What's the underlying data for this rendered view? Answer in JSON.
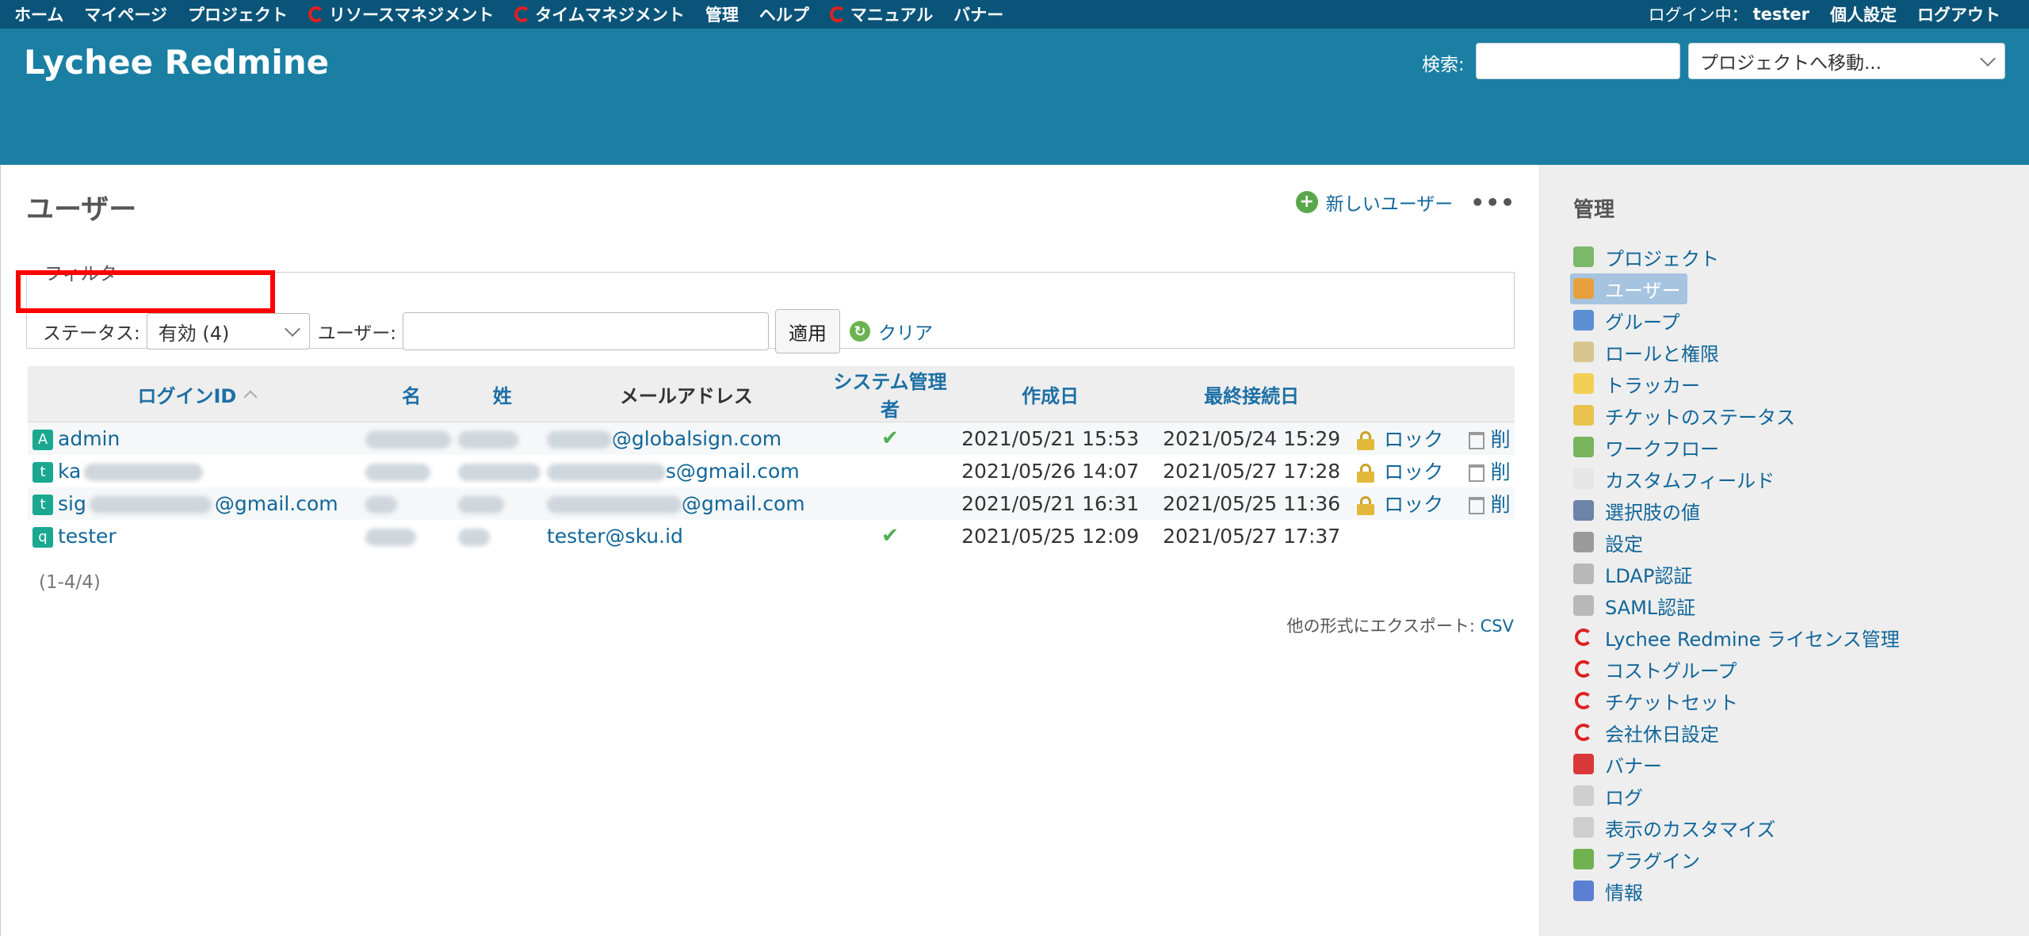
{
  "top_menu": {
    "items": [
      {
        "label": "ホーム",
        "ring": false
      },
      {
        "label": "マイページ",
        "ring": false
      },
      {
        "label": "プロジェクト",
        "ring": false
      },
      {
        "label": "リソースマネジメント",
        "ring": true
      },
      {
        "label": "タイムマネジメント",
        "ring": true
      },
      {
        "label": "管理",
        "ring": false
      },
      {
        "label": "ヘルプ",
        "ring": false
      },
      {
        "label": "マニュアル",
        "ring": true
      },
      {
        "label": "バナー",
        "ring": false
      }
    ],
    "logged_in_label": "ログイン中：",
    "logged_in_user": "tester",
    "my_account": "個人設定",
    "logout": "ログアウト"
  },
  "header": {
    "title": "Lychee Redmine",
    "search_label": "検索:",
    "search_value": "",
    "project_jump": "プロジェクトへ移動..."
  },
  "main": {
    "title": "ユーザー",
    "new_user": "新しいユーザー",
    "filters": {
      "legend": "フィルタ",
      "status_label": "ステータス:",
      "status_value": "有効 (4)",
      "user_label": "ユーザー:",
      "user_value": "",
      "apply": "適用",
      "clear": "クリア"
    },
    "table": {
      "headers": {
        "login": "ログインID",
        "firstname": "名",
        "lastname": "姓",
        "mail": "メールアドレス",
        "admin": "システム管理者",
        "created": "作成日",
        "last_login": "最終接続日"
      },
      "rows": [
        {
          "avatar": "A",
          "login": "admin",
          "mail": "@globalsign.com",
          "admin": "✔",
          "created": "2021/05/21 15:53",
          "last_login": "2021/05/24 15:29",
          "lock": "ロック",
          "delete": "削"
        },
        {
          "avatar": "t",
          "login": "ka",
          "mail": "s@gmail.com",
          "admin": "",
          "created": "2021/05/26 14:07",
          "last_login": "2021/05/27 17:28",
          "lock": "ロック",
          "delete": "削"
        },
        {
          "avatar": "t",
          "login": "sig",
          "login_suffix": "@gmail.com",
          "mail": "@gmail.com",
          "admin": "",
          "created": "2021/05/21 16:31",
          "last_login": "2021/05/25 11:36",
          "lock": "ロック",
          "delete": "削"
        },
        {
          "avatar": "q",
          "login": "tester",
          "mail": "tester@sku.id",
          "admin": "✔",
          "created": "2021/05/25 12:09",
          "last_login": "2021/05/27 17:37",
          "lock": "",
          "delete": ""
        }
      ]
    },
    "pagination": "(1-4/4)",
    "other_formats_label": "他の形式にエクスポート:",
    "csv": "CSV"
  },
  "sidebar": {
    "title": "管理",
    "items": [
      {
        "label": "プロジェクト",
        "icon": "projects-icon",
        "color": "#7cb86a"
      },
      {
        "label": "ユーザー",
        "icon": "user-icon",
        "color": "#e7a13c",
        "selected": true
      },
      {
        "label": "グループ",
        "icon": "group-icon",
        "color": "#5b8fd1"
      },
      {
        "label": "ロールと権限",
        "icon": "roles-icon",
        "color": "#d7c58f"
      },
      {
        "label": "トラッカー",
        "icon": "tracker-icon",
        "color": "#f3cf55"
      },
      {
        "label": "チケットのステータス",
        "icon": "issue-status-icon",
        "color": "#e9c34e"
      },
      {
        "label": "ワークフロー",
        "icon": "workflow-icon",
        "color": "#78b45c"
      },
      {
        "label": "カスタムフィールド",
        "icon": "custom-field-icon",
        "color": "#e6e6e6"
      },
      {
        "label": "選択肢の値",
        "icon": "enumeration-icon",
        "color": "#6b84a8"
      },
      {
        "label": "設定",
        "icon": "settings-icon",
        "color": "#9a9a9a"
      },
      {
        "label": "LDAP認証",
        "icon": "ldap-icon",
        "color": "#b8b8b8"
      },
      {
        "label": "SAML認証",
        "icon": "saml-icon",
        "color": "#b8b8b8"
      },
      {
        "label": "Lychee Redmine ライセンス管理",
        "icon": "lychee-ring-icon",
        "ring": true
      },
      {
        "label": "コストグループ",
        "icon": "lychee-ring-icon",
        "ring": true
      },
      {
        "label": "チケットセット",
        "icon": "lychee-ring-icon",
        "ring": true
      },
      {
        "label": "会社休日設定",
        "icon": "lychee-ring-icon",
        "ring": true
      },
      {
        "label": "バナー",
        "icon": "banner-icon",
        "color": "#d93838"
      },
      {
        "label": "ログ",
        "icon": "log-icon",
        "color": "#cfcfcf"
      },
      {
        "label": "表示のカスタマイズ",
        "icon": "customize-icon",
        "color": "#cfcfcf"
      },
      {
        "label": "プラグイン",
        "icon": "plugin-icon",
        "color": "#6fb24f"
      },
      {
        "label": "情報",
        "icon": "info-icon",
        "color": "#5b7fd1"
      }
    ]
  }
}
